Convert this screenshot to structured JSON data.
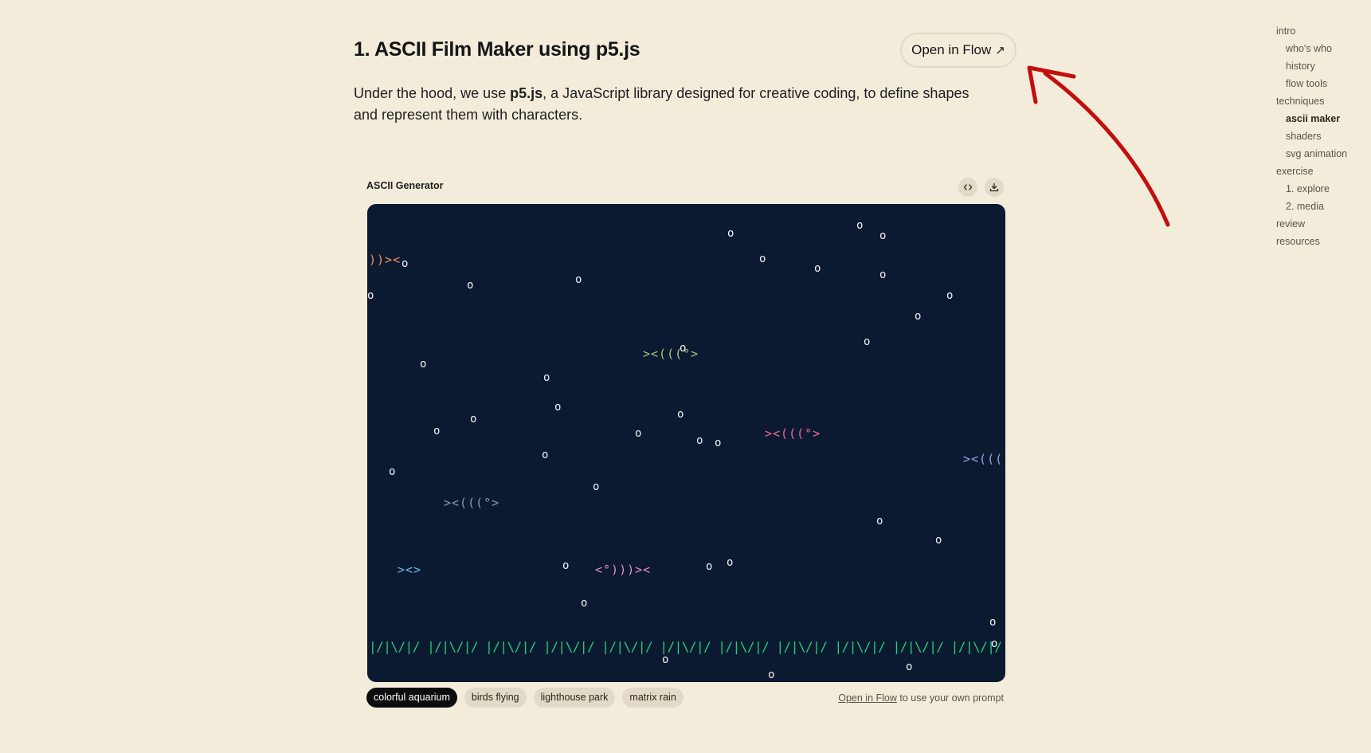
{
  "section": {
    "title": "1. ASCII Film Maker using p5.js",
    "open_button_label": "Open in Flow",
    "intro_before": "Under the hood, we use ",
    "intro_bold": "p5.js",
    "intro_after": ", a JavaScript library designed for creative coding, to define shapes and represent them with characters."
  },
  "toc": {
    "items": [
      {
        "label": "intro",
        "level": 1,
        "active": false
      },
      {
        "label": "who's who",
        "level": 2,
        "active": false
      },
      {
        "label": "history",
        "level": 2,
        "active": false
      },
      {
        "label": "flow tools",
        "level": 2,
        "active": false
      },
      {
        "label": "techniques",
        "level": 1,
        "active": false
      },
      {
        "label": "ascii maker",
        "level": 2,
        "active": true
      },
      {
        "label": "shaders",
        "level": 2,
        "active": false
      },
      {
        "label": "svg animation",
        "level": 2,
        "active": false
      },
      {
        "label": "exercise",
        "level": 1,
        "active": false
      },
      {
        "label": "1. explore",
        "level": 2,
        "active": false
      },
      {
        "label": "2. media",
        "level": 2,
        "active": false
      },
      {
        "label": "review",
        "level": 1,
        "active": false
      },
      {
        "label": "resources",
        "level": 1,
        "active": false
      }
    ]
  },
  "generator": {
    "title": "ASCII Generator",
    "code_icon": "code-icon",
    "download_icon": "download-icon",
    "bubble_char": "o",
    "fish": [
      {
        "text": "))><",
        "color": "#e8906a"
      },
      {
        "text": "><(((°>",
        "color": "#a9c47a"
      },
      {
        "text": "><(((°>",
        "color": "#f06b9a"
      },
      {
        "text": "><(((",
        "color": "#9aa6e8"
      },
      {
        "text": "><(((°>",
        "color": "#8a9bb8"
      },
      {
        "text": "><>",
        "color": "#6ab8ee"
      },
      {
        "text": "<°)))><",
        "color": "#e88ac4"
      }
    ],
    "seaweed": "|/|\\/|/ |/|\\/|/ |/|\\/|/ |/|\\/|/ |/|\\/|/ |/|\\/|/ |/|\\/|/ |/|\\/|/ |/|\\/|/ |/|\\/|/ |/|\\/|/ |/|\\/|/ |/|\\/|/ |/|\\/|/ |/|\\/|/ |/|\\/|/ |/|\\/|/ |/|\\/|/ |/|\\/|/ |/\\/| |\\",
    "seaweed_color": "#1fd07a",
    "background_color": "#0b1a30"
  },
  "prompts": {
    "chips": [
      {
        "label": "colorful aquarium",
        "active": true
      },
      {
        "label": "birds flying",
        "active": false
      },
      {
        "label": "lighthouse park",
        "active": false
      },
      {
        "label": "matrix rain",
        "active": false
      }
    ],
    "note_link": "Open in Flow",
    "note_text": " to use your own prompt"
  }
}
